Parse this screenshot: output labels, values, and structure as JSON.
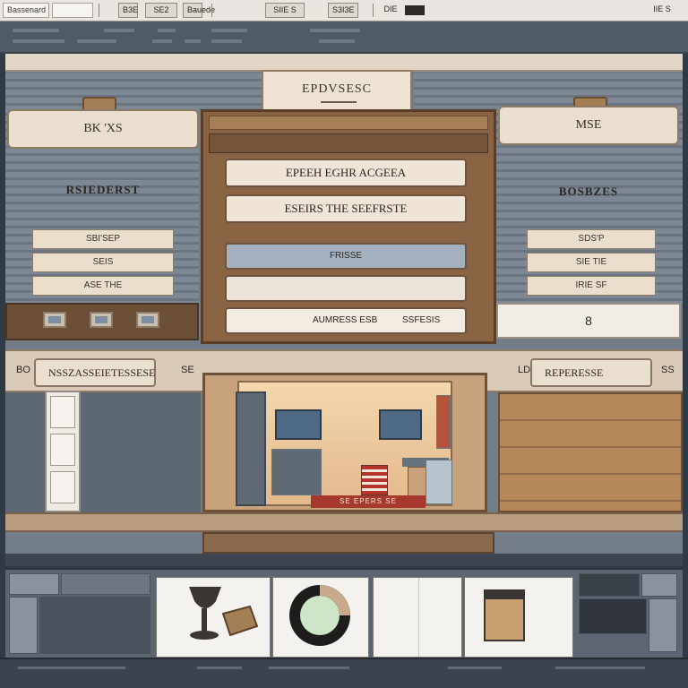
{
  "toolbar": {
    "field1": "Bassenard",
    "field2": "",
    "btn1": "B3E",
    "btn2": "SE2",
    "btn3": "Bauede",
    "btn4": "SIIE S",
    "btn5": "S3I3E",
    "btn6": "DIE",
    "btn7": "IIE S"
  },
  "stage": {
    "title": "EPDVSESC",
    "left_panel": {
      "heading": "BK 'XS",
      "label": "RSIEDERST",
      "items": [
        "SBI'SEP",
        "SEIS",
        "ASE THE"
      ]
    },
    "right_panel": {
      "heading": "MSE",
      "label": "BOSBZES",
      "items": [
        "SDS'P",
        "SIE TIE",
        "IRIE SF"
      ],
      "row_value": "8"
    },
    "center": {
      "btn1": "EPEEH EGHR ACGEEA",
      "btn2": "ESEIRS THE SEEFRSTE",
      "field1": "FRISSE",
      "field2": "",
      "field3_left": "AUMRESS ESB",
      "field3_right": "SSFESIS"
    },
    "lower": {
      "left_label": "BO",
      "left_field": "NSSZASSEIETESSESE",
      "left_right_label": "SE",
      "right_label": "LDI",
      "right_field": "REPERESSE",
      "right_right_label": "SS"
    },
    "room_sign": "SE EPERS SE"
  },
  "tray": {
    "card_icons": [
      "goblet-icon",
      "donut-chart-icon",
      "blank-card",
      "frame-icon"
    ]
  },
  "colors": {
    "accent_brown": "#8a6442",
    "cream": "#eadfce",
    "slate": "#727d88"
  }
}
